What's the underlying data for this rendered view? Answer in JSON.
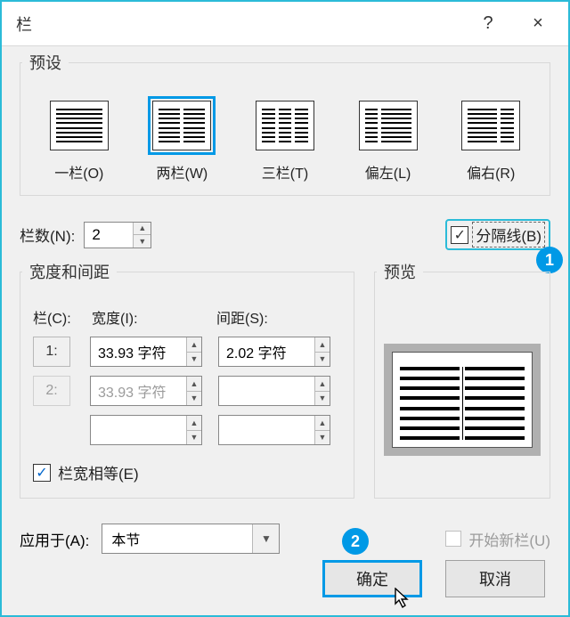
{
  "title": "栏",
  "help": "?",
  "close": "×",
  "preset": {
    "legend": "预设",
    "items": [
      {
        "label": "一栏(O)",
        "cols": 1,
        "selected": false
      },
      {
        "label": "两栏(W)",
        "cols": 2,
        "selected": true
      },
      {
        "label": "三栏(T)",
        "cols": 3,
        "selected": false
      },
      {
        "label": "偏左(L)",
        "cols": "left",
        "selected": false
      },
      {
        "label": "偏右(R)",
        "cols": "right",
        "selected": false
      }
    ]
  },
  "numcols": {
    "label": "栏数(N):",
    "value": "2"
  },
  "separator": {
    "label": "分隔线(B)",
    "checked": true
  },
  "ws": {
    "legend": "宽度和间距",
    "head_col": "栏(C):",
    "head_width": "宽度(I):",
    "head_spacing": "间距(S):",
    "rows": [
      {
        "idx": "1:",
        "width": "33.93 字符",
        "spacing": "2.02 字符",
        "enabled": true
      },
      {
        "idx": "2:",
        "width": "33.93 字符",
        "spacing": "",
        "enabled": false
      },
      {
        "idx": "",
        "width": "",
        "spacing": "",
        "enabled": false
      }
    ],
    "equal": {
      "label": "栏宽相等(E)",
      "checked": true
    }
  },
  "preview": {
    "legend": "预览"
  },
  "apply": {
    "label": "应用于(A):",
    "value": "本节"
  },
  "start_new": {
    "label": "开始新栏(U)",
    "checked": false
  },
  "ok": "确定",
  "cancel": "取消",
  "badges": {
    "one": "1",
    "two": "2"
  }
}
